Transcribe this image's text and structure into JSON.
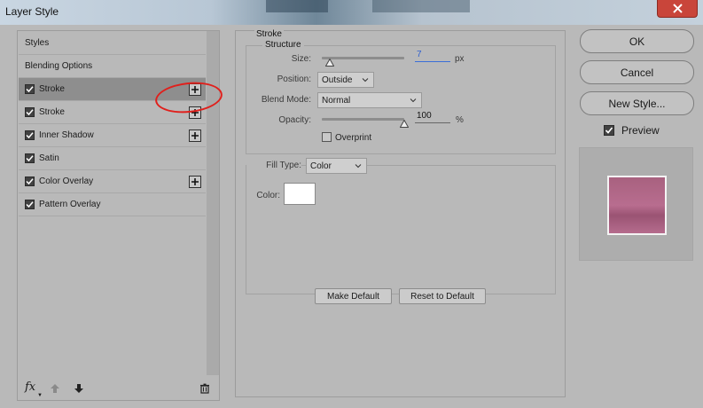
{
  "window": {
    "title": "Layer Style",
    "close_icon": "close-icon"
  },
  "styles_panel": {
    "items": [
      {
        "label": "Styles",
        "checkbox": false,
        "checked": false,
        "plus": false,
        "selected": false
      },
      {
        "label": "Blending Options",
        "checkbox": false,
        "checked": false,
        "plus": false,
        "selected": false
      },
      {
        "label": "Stroke",
        "checkbox": true,
        "checked": true,
        "plus": true,
        "selected": true
      },
      {
        "label": "Stroke",
        "checkbox": true,
        "checked": true,
        "plus": true,
        "selected": false
      },
      {
        "label": "Inner Shadow",
        "checkbox": true,
        "checked": true,
        "plus": true,
        "selected": false
      },
      {
        "label": "Satin",
        "checkbox": true,
        "checked": true,
        "plus": false,
        "selected": false
      },
      {
        "label": "Color Overlay",
        "checkbox": true,
        "checked": true,
        "plus": true,
        "selected": false
      },
      {
        "label": "Pattern Overlay",
        "checkbox": true,
        "checked": true,
        "plus": false,
        "selected": false
      }
    ],
    "footer": {
      "fx_label": "fx",
      "icons": [
        "fx-menu-icon",
        "move-up-icon",
        "move-down-icon",
        "trash-icon"
      ]
    }
  },
  "stroke": {
    "section_title": "Stroke",
    "structure": {
      "title": "Structure",
      "size_label": "Size:",
      "size_value": "7",
      "size_unit": "px",
      "size_slider_value": 7,
      "position_label": "Position:",
      "position_value": "Outside",
      "blend_mode_label": "Blend Mode:",
      "blend_mode_value": "Normal",
      "opacity_label": "Opacity:",
      "opacity_value": "100",
      "opacity_unit": "%",
      "opacity_slider_value": 100,
      "overprint_label": "Overprint",
      "overprint_checked": false
    },
    "fill": {
      "fill_type_label": "Fill Type:",
      "fill_type_value": "Color",
      "color_label": "Color:",
      "color_value": "#ffffff"
    },
    "buttons": {
      "make_default": "Make Default",
      "reset_default": "Reset to Default"
    }
  },
  "actions": {
    "ok": "OK",
    "cancel": "Cancel",
    "new_style": "New Style..."
  },
  "preview": {
    "label": "Preview",
    "checked": true,
    "swatch_color": "#b06a8a"
  },
  "colors": {
    "dialog_bg": "#b9b9b9",
    "selected_row": "#8e8e8e",
    "highlight_circle": "#e0201c",
    "active_input": "#2e5fd0"
  }
}
